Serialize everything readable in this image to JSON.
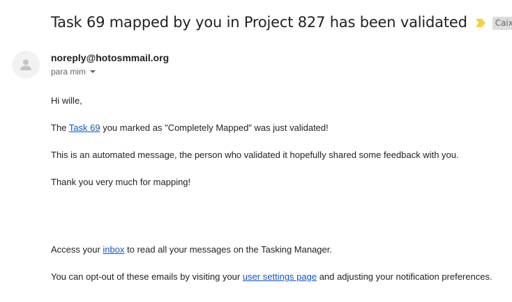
{
  "email": {
    "subject": "Task 69 mapped by you in Project 827 has been validated",
    "label": "Caixa de e",
    "importance_icon": "importance-marker-icon",
    "importance_color": "#f5d145",
    "sender": "noreply@hotosmmail.org",
    "recipient": "para mim",
    "avatar_icon": "person-icon"
  },
  "body": {
    "greeting": "Hi wille,",
    "line1": {
      "prefix": "The ",
      "link": "Task 69",
      "suffix": " you marked as \"Completely Mapped\" was just validated!"
    },
    "line2": "This is an automated message, the person who validated it hopefully shared some feedback with you.",
    "line3": "Thank you very much for mapping!",
    "line4": {
      "prefix": "Access your ",
      "link": "inbox",
      "suffix": " to read all your messages on the Tasking Manager."
    },
    "line5": {
      "prefix": "You can opt-out of these emails by visiting your ",
      "link": "user settings page",
      "suffix": " and adjusting your notification preferences."
    }
  },
  "colors": {
    "link": "#1155cc",
    "text": "#222222",
    "muted": "#5f6368",
    "chip_bg": "#dddddd"
  }
}
